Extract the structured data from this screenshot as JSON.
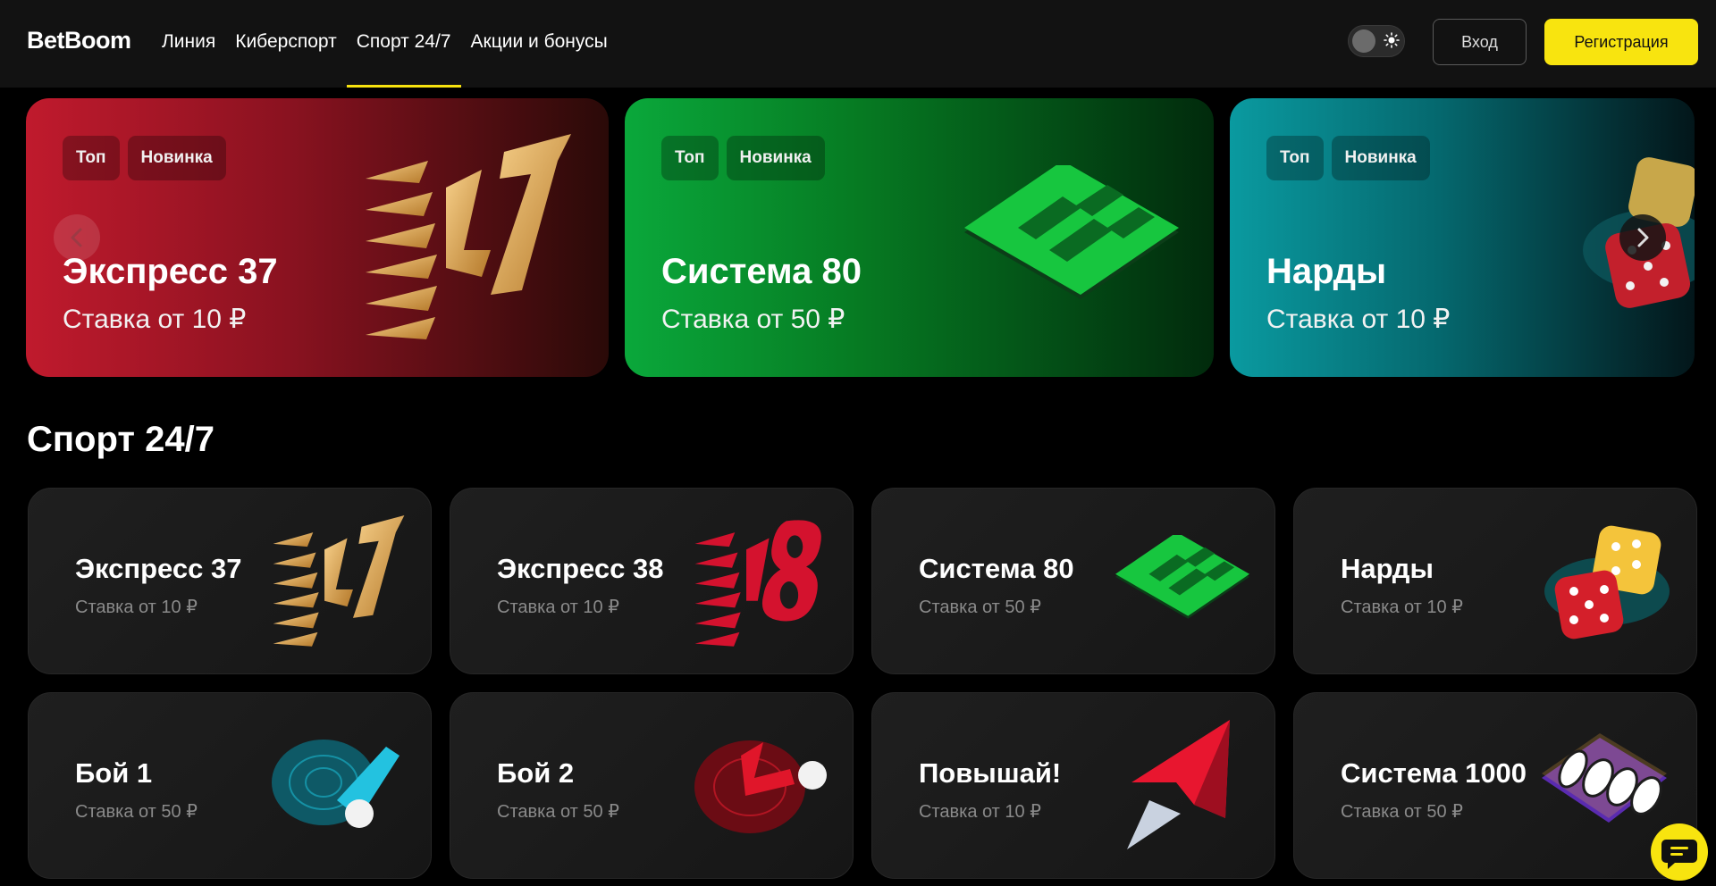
{
  "header": {
    "logo": "BetBoom",
    "nav": [
      "Линия",
      "Киберспорт",
      "Спорт 24/7",
      "Акции и бонусы"
    ],
    "active_nav": "Спорт 24/7",
    "login_label": "Вход",
    "register_label": "Регистрация",
    "accent_color": "#f8e40f"
  },
  "banners": [
    {
      "tags": [
        "Топ",
        "Новинка"
      ],
      "title": "Экспресс 37",
      "subtitle": "Ставка от 10 ₽",
      "art": "number-37-icon"
    },
    {
      "tags": [
        "Топ",
        "Новинка"
      ],
      "title": "Система 80",
      "subtitle": "Ставка от 50 ₽",
      "art": "number-80-icon"
    },
    {
      "tags": [
        "Топ",
        "Новинка"
      ],
      "title": "Нарды",
      "subtitle": "Ставка от 10 ₽",
      "art": "dice-icon"
    }
  ],
  "section": {
    "title": "Спорт 24/7"
  },
  "games": [
    {
      "title": "Экспресс 37",
      "subtitle": "Ставка от 10 ₽",
      "art": "number-37-icon"
    },
    {
      "title": "Экспресс 38",
      "subtitle": "Ставка от 10 ₽",
      "art": "number-38-icon"
    },
    {
      "title": "Система 80",
      "subtitle": "Ставка от 50 ₽",
      "art": "number-80-icon"
    },
    {
      "title": "Нарды",
      "subtitle": "Ставка от 10 ₽",
      "art": "dice-icon"
    },
    {
      "title": "Бой 1",
      "subtitle": "Ставка от 50 ₽",
      "art": "blue-ball-icon"
    },
    {
      "title": "Бой 2",
      "subtitle": "Ставка от 50 ₽",
      "art": "red-ball-icon"
    },
    {
      "title": "Повышай!",
      "subtitle": "Ставка от 10 ₽",
      "art": "arrow-up-icon"
    },
    {
      "title": "Система 1000",
      "subtitle": "Ставка от 50 ₽",
      "art": "number-1000-icon"
    }
  ]
}
